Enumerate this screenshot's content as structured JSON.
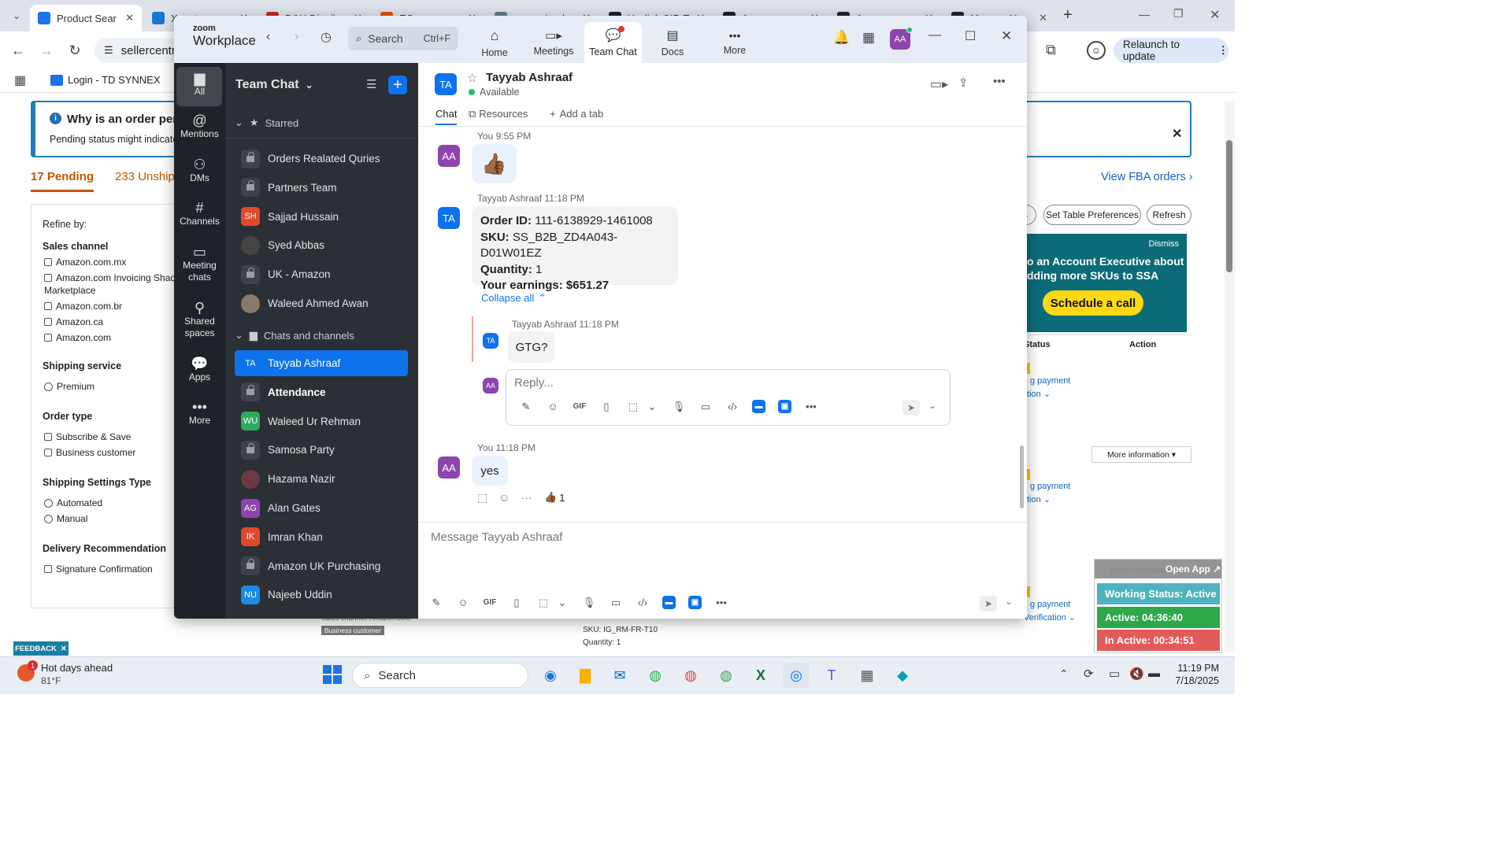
{
  "browser": {
    "tabs": [
      {
        "label": "Product Sear",
        "color": "#1a73e8"
      },
      {
        "label": "Xuantong",
        "color": "#1976d2"
      },
      {
        "label": "D&H Distrib",
        "color": "#c62828"
      },
      {
        "label": "ECommerce",
        "color": "#e65100"
      },
      {
        "label": "www.wipedr",
        "color": "#607d8b"
      },
      {
        "label": "Yealink SIP-T",
        "color": "#222222"
      },
      {
        "label": "Amazon",
        "color": "#222222"
      },
      {
        "label": "Amazon",
        "color": "#222222"
      },
      {
        "label": "Manage Yo",
        "color": "#222222"
      }
    ],
    "url": "sellercentral.amazon.com",
    "bookmark": "Login - TD SYNNEX",
    "relaunch": "Relaunch to update"
  },
  "seller": {
    "alert_title": "Why is an order pen",
    "alert_text": "Pending status might indicate",
    "pending_tab": "17 Pending",
    "unship_tab": "233 Unship",
    "view_fba": "View FBA orders",
    "set_table": "Set Table Preferences",
    "refresh": "Refresh",
    "dismiss": "Dismiss",
    "promo_line1": "o an Account Executive about",
    "promo_line2": "dding more SKUs to SSA",
    "schedule": "Schedule a call",
    "col_status": "Status",
    "col_action": "Action",
    "pay1": "g payment",
    "tion1": "tion",
    "more_info": "More information",
    "pay2": "g payment",
    "tion2": "tion",
    "pay3": "g payment",
    "tion3": "Verification",
    "bottom_sku": "SKU: IG_RM-FR-T10",
    "bottom_qty": "Quantity: 1",
    "bottom_channel": "Sales channel: Amazon.com",
    "bottom_badge": "Business customer",
    "refine_by": "Refine by:",
    "filters": {
      "sales_channel": "Sales channel",
      "channels": [
        "Amazon.com.mx",
        "Amazon.com Invoicing Shado",
        "Marketplace",
        "Amazon.com.br",
        "Amazon.ca",
        "Amazon.com"
      ],
      "shipping_service": "Shipping service",
      "premium": "Premium",
      "order_type": "Order type",
      "subscribe": "Subscribe & Save",
      "business": "Business customer",
      "shipping_settings": "Shipping Settings Type",
      "automated": "Automated",
      "manual": "Manual",
      "delivery_rec": "Delivery Recommendation",
      "signature": "Signature Confirmation"
    }
  },
  "zoom": {
    "logo_small": "zoom",
    "logo_big": "Workplace",
    "search": "Search",
    "search_shortcut": "Ctrl+F",
    "nav": [
      "Home",
      "Meetings",
      "Team Chat",
      "Docs",
      "More"
    ],
    "user_initials": "AA",
    "rail": [
      "All",
      "Mentions",
      "DMs",
      "Channels",
      "Meeting chats",
      "Shared spaces",
      "Apps",
      "More"
    ],
    "panel_title": "Team Chat",
    "starred": "Starred",
    "starred_items": [
      {
        "label": "Orders Realated Quries",
        "type": "lock"
      },
      {
        "label": "Partners Team",
        "type": "lock"
      },
      {
        "label": "Sajjad Hussain",
        "type": "avatar",
        "initials": "SH",
        "color": "#e0492f"
      },
      {
        "label": "Syed Abbas",
        "type": "photo",
        "color": "#444444"
      },
      {
        "label": "UK - Amazon",
        "type": "lock"
      },
      {
        "label": "Waleed Ahmed Awan",
        "type": "photo",
        "color": "#8a7a6a"
      }
    ],
    "chats_header": "Chats and channels",
    "chat_items": [
      {
        "label": "Tayyab Ashraaf",
        "type": "avatar",
        "initials": "TA",
        "color": "#0e72ed",
        "selected": true
      },
      {
        "label": "Attendance",
        "type": "lock",
        "bold": true
      },
      {
        "label": "Waleed Ur Rehman",
        "type": "avatar",
        "initials": "WU",
        "color": "#2eaa5c"
      },
      {
        "label": "Samosa Party",
        "type": "lock"
      },
      {
        "label": "Hazama Nazir",
        "type": "photo",
        "color": "#6b3a44"
      },
      {
        "label": "Alan Gates",
        "type": "avatar",
        "initials": "AG",
        "color": "#8e44ad"
      },
      {
        "label": "Imran Khan",
        "type": "avatar",
        "initials": "IK",
        "color": "#e0492f"
      },
      {
        "label": "Amazon UK Purchasing",
        "type": "lock"
      },
      {
        "label": "Najeeb Uddin",
        "type": "avatar",
        "initials": "NU",
        "color": "#1e88e5"
      }
    ],
    "contact_name": "Tayyab Ashraaf",
    "contact_initials": "TA",
    "contact_status": "Available",
    "tabs": [
      "Chat",
      "Resources",
      "Add a tab"
    ],
    "messages": {
      "m1_meta": "You 9:55 PM",
      "m1_initials": "AA",
      "m1_emoji": "👍🏾",
      "m2_meta_name": "Tayyab Ashraaf",
      "m2_meta_time": "11:18 PM",
      "m2_initials": "TA",
      "order_label": "Order ID:",
      "order_value": "111-6138929-1461008",
      "sku_label": "SKU:",
      "sku_value": "SS_B2B_ZD4A043-D01W01EZ",
      "qty_label": "Quantity:",
      "qty_value": "1",
      "earn_label": "Your earnings:",
      "earn_value": "$651.27",
      "collapse": "Collapse all",
      "reply_name": "Tayyab Ashraaf",
      "reply_time": "11:18 PM",
      "reply_initials": "TA",
      "reply_text": "GTG?",
      "reply_placeholder": "Reply...",
      "reply_avatar": "AA",
      "m3_meta": "You 11:18 PM",
      "m3_initials": "AA",
      "m3_text": "yes",
      "reaction": "👍🏾",
      "reaction_count": "1"
    },
    "composer_placeholder": "Message Tayyab Ashraaf",
    "gif": "GIF"
  },
  "working_status": {
    "open_app": "Open App ↗",
    "more_info": "More information",
    "status": "Working Status: Active",
    "active": "Active: 04:36:40",
    "inactive": "In Active: 00:34:51",
    "colors": {
      "status": "#4fb3bf",
      "active": "#2ea84a",
      "inactive": "#e25a5a"
    }
  },
  "feedback": "FEEDBACK",
  "taskbar": {
    "weather_title": "Hot days ahead",
    "weather_temp": "81°F",
    "weather_badge": "1",
    "search": "Search",
    "time": "11:19 PM",
    "date": "7/18/2025"
  }
}
